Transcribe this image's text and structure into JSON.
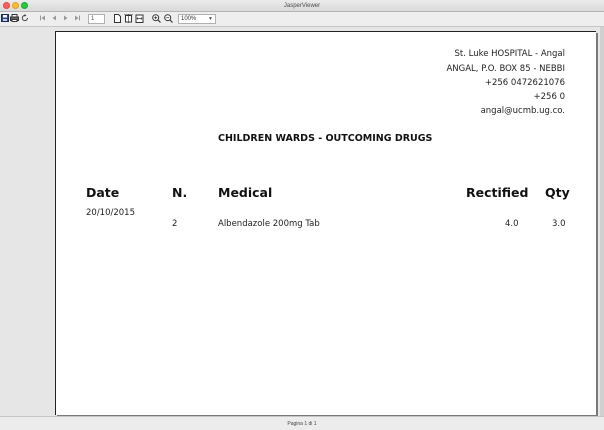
{
  "window": {
    "title": "JasperViewer"
  },
  "toolbar": {
    "icons": [
      "save-icon",
      "print-icon",
      "reload-icon",
      "first-page-icon",
      "previous-page-icon",
      "next-page-icon",
      "last-page-icon",
      "actual-size-icon",
      "fit-page-icon",
      "fit-width-icon",
      "zoom-in-icon",
      "zoom-out-icon"
    ],
    "page_number": "1",
    "zoom_level": "100%"
  },
  "report": {
    "header_lines": [
      "St. Luke HOSPITAL - Angal",
      "ANGAL, P.O. BOX 85 - NEBBI",
      "+256 0472621076",
      "+256 0",
      "angal@ucmb.ug.co."
    ],
    "title": "CHILDREN WARDS - OUTCOMING DRUGS",
    "columns": {
      "date": "Date",
      "number": "N.",
      "medical": "Medical",
      "rectified": "Rectified",
      "qty": "Qty"
    },
    "rows": [
      {
        "date": "20/10/2015",
        "number": "2",
        "medical": "Albendazole 200mg Tab",
        "rectified": "4.0",
        "qty": "3.0"
      }
    ]
  },
  "status": {
    "page_indicator": "Pagina 1 di 1"
  }
}
